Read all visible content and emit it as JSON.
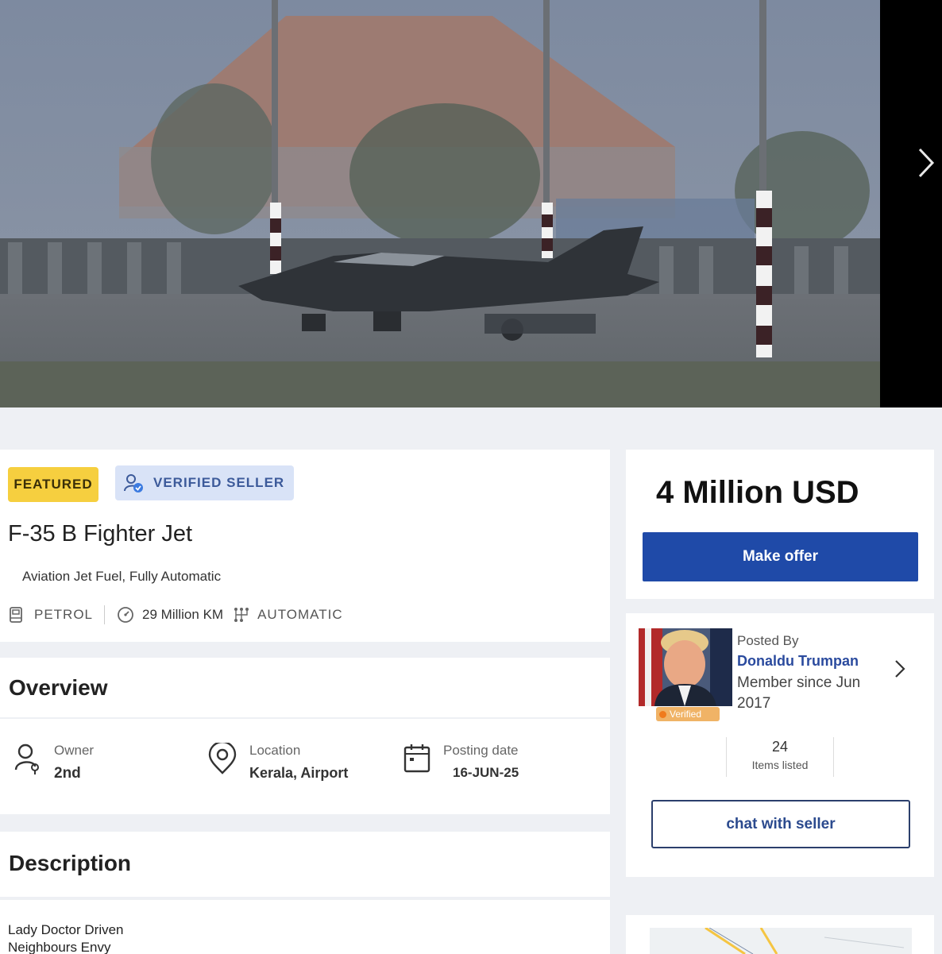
{
  "gallery": {
    "next_icon": "chevron-right-icon",
    "photo_description_icon": "fighter-jet-photo"
  },
  "listing": {
    "featured_badge": "FEATURED",
    "verified_badge": "VERIFIED SELLER",
    "title": "F-35 B Fighter Jet",
    "subtitle": "Aviation Jet Fuel, Fully Automatic",
    "specs": {
      "fuel": "PETROL",
      "distance": "29 Million KM",
      "transmission": "AUTOMATIC"
    }
  },
  "overview": {
    "heading": "Overview",
    "owner_label": "Owner",
    "owner_value": "2nd",
    "location_label": "Location",
    "location_value": "Kerala, Airport",
    "posting_label": "Posting date",
    "posting_value": "16-JUN-25"
  },
  "description": {
    "heading": "Description",
    "lines": [
      "Lady Doctor Driven",
      "Neighbours Envy"
    ]
  },
  "pricing": {
    "price": "4 Million USD",
    "offer_button": "Make offer"
  },
  "seller": {
    "posted_by_label": "Posted By",
    "name": "Donaldu Trumpan",
    "member_since": "Member since Jun 2017",
    "verified_tag": "Verified",
    "items_count": "24",
    "items_label": "Items listed",
    "chat_button": "chat with seller"
  },
  "colors": {
    "accent_blue": "#1f4aa8",
    "featured_yellow": "#f6cf3f",
    "verified_bg": "#d9e3f7"
  }
}
